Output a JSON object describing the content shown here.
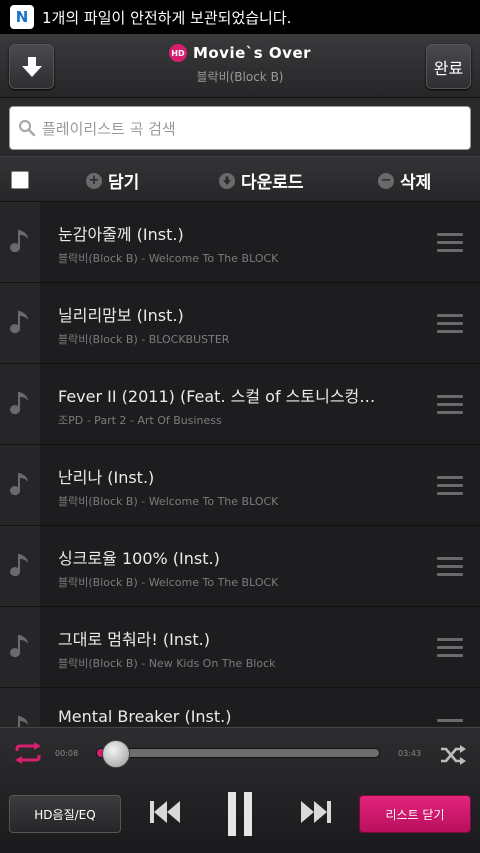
{
  "notification": {
    "icon": "n-app-icon",
    "text": "1개의 파일이 안전하게 보관되었습니다."
  },
  "header": {
    "quality_badge": "HD",
    "song_title": "Movie`s Over",
    "artist": "블락비(Block B)",
    "done_label": "완료"
  },
  "search": {
    "placeholder": "플레이리스트 곡 검색"
  },
  "actions": {
    "add_label": "담기",
    "download_label": "다운로드",
    "delete_label": "삭제"
  },
  "playlist": [
    {
      "title": "눈감아줄께 (Inst.)",
      "subtitle": "블락비(Block B) - Welcome To The BLOCK"
    },
    {
      "title": "닐리리맘보 (Inst.)",
      "subtitle": "블락비(Block B) - BLOCKBUSTER"
    },
    {
      "title": "Fever II (2011) (Feat. 스컬 of 스토니스컹…",
      "subtitle": "조PD - Part 2 - Art Of Business"
    },
    {
      "title": "난리나 (Inst.)",
      "subtitle": "블락비(Block B) - Welcome To The BLOCK"
    },
    {
      "title": "싱크로율 100% (Inst.)",
      "subtitle": "블락비(Block B) - Welcome To The BLOCK"
    },
    {
      "title": "그대로 멈춰라! (Inst.)",
      "subtitle": "블락비(Block B) - New Kids On The Block"
    },
    {
      "title": "Mental Breaker (Inst.)",
      "subtitle": ""
    }
  ],
  "player": {
    "elapsed": "00:08",
    "duration": "03:43",
    "progress_fraction": 0.036,
    "eq_label": "HD음질/EQ",
    "close_list_label": "리스트 닫기",
    "accent_color": "#d81e6e"
  }
}
